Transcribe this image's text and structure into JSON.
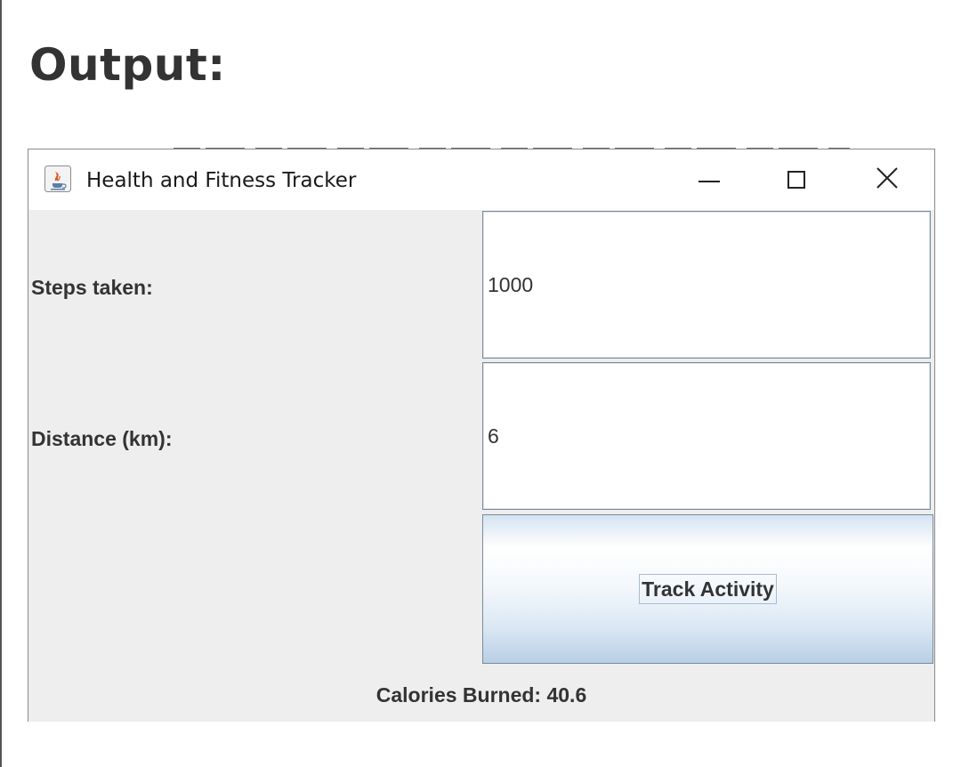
{
  "page": {
    "heading": "Output:"
  },
  "window": {
    "title": "Health and Fitness Tracker",
    "icon": "java-cup-icon",
    "controls": {
      "minimize": "minimize-icon",
      "maximize": "maximize-icon",
      "close": "close-icon"
    }
  },
  "form": {
    "steps_label": "Steps taken:",
    "steps_value": "1000",
    "distance_label": "Distance (km):",
    "distance_value": "6",
    "track_button_label": "Track Activity",
    "result_text": "Calories Burned: 40.6"
  },
  "colors": {
    "window_background": "#eeeeee",
    "titlebar_background": "#ffffff",
    "label_text": "#333333",
    "field_border": "#7a8a99",
    "button_gradient_bottom": "#b8cfe5"
  }
}
